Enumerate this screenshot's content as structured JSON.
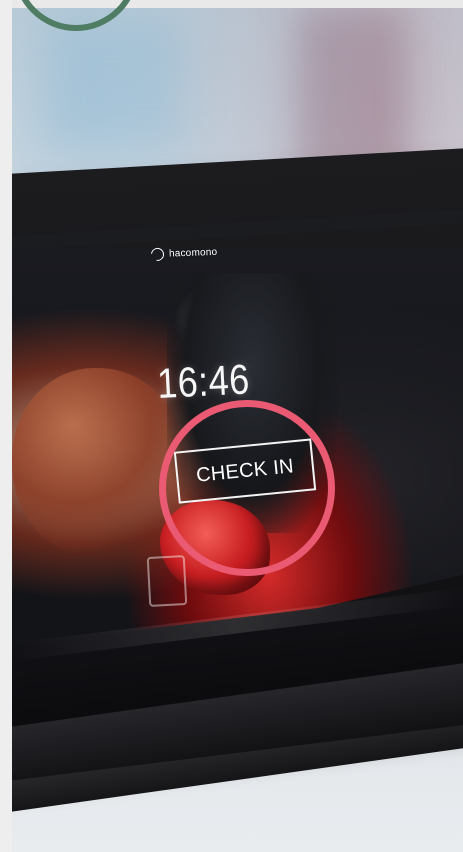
{
  "screen": {
    "brand_text": "hacomono",
    "time": "16:46",
    "check_in_label": "CHECK IN"
  },
  "colors": {
    "highlight_ring": "#ea5a72",
    "corner_badge": "#4f7d63",
    "tablet_body": "#111114"
  },
  "icons": {
    "brand_logo": "hacomono-logo-icon"
  }
}
